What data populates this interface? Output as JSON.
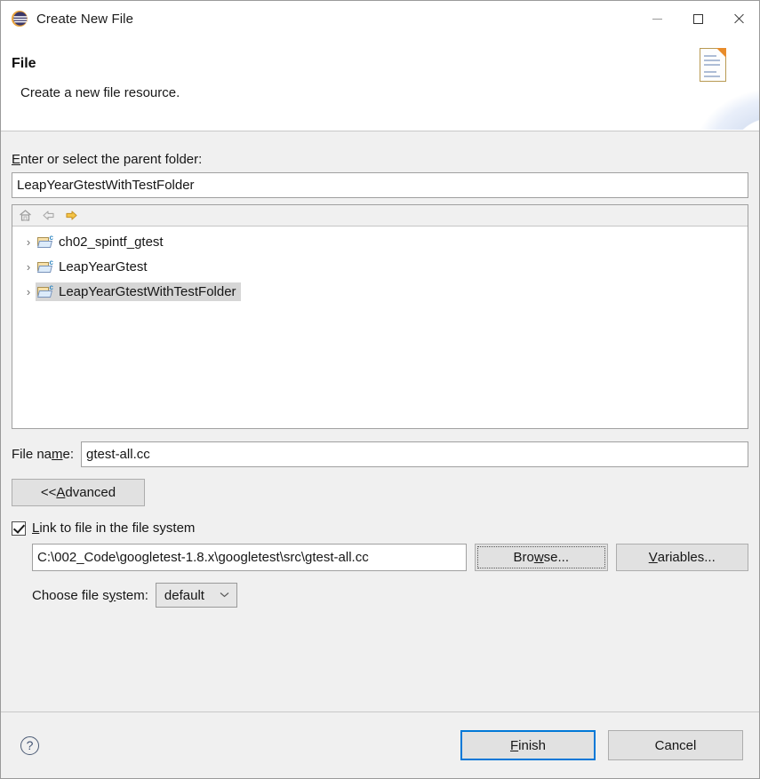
{
  "window": {
    "title": "Create New File",
    "app_icon": "eclipse-icon",
    "controls": {
      "minimize": "minimize-icon",
      "maximize": "maximize-icon",
      "close": "close-icon"
    }
  },
  "header": {
    "title": "File",
    "subtitle": "Create a new file resource.",
    "banner_icon": "document-icon"
  },
  "parent_folder": {
    "label_pre": "",
    "label_mnemonic": "E",
    "label_post": "nter or select the parent folder:",
    "value": "LeapYearGtestWithTestFolder",
    "toolbar": [
      {
        "name": "home-icon",
        "title": "Home"
      },
      {
        "name": "back-arrow-icon",
        "title": "Back"
      },
      {
        "name": "forward-arrow-icon",
        "title": "Forward"
      }
    ],
    "tree": [
      {
        "label": "ch02_spintf_gtest",
        "icon": "cpp-project-folder-icon",
        "expander": "›",
        "selected": false
      },
      {
        "label": "LeapYearGtest",
        "icon": "cpp-project-folder-icon",
        "expander": "›",
        "selected": false
      },
      {
        "label": "LeapYearGtestWithTestFolder",
        "icon": "cpp-project-folder-icon",
        "expander": "›",
        "selected": true
      }
    ]
  },
  "file_name": {
    "label_pre": "File na",
    "label_mnemonic": "m",
    "label_post": "e:",
    "value": "gtest-all.cc"
  },
  "advanced_button": {
    "label_pre": "<< ",
    "label_mnemonic": "A",
    "label_post": "dvanced"
  },
  "link_section": {
    "checkbox": {
      "checked": true,
      "label_pre": "",
      "label_mnemonic": "L",
      "label_post": "ink to file in the file system"
    },
    "path_value": "C:\\002_Code\\googletest-1.8.x\\googletest\\src\\gtest-all.cc",
    "browse_button": {
      "label_pre": "Bro",
      "label_mnemonic": "w",
      "label_post": "se...",
      "focused": true
    },
    "variables_button": {
      "label_pre": "",
      "label_mnemonic": "V",
      "label_post": "ariables..."
    },
    "file_system": {
      "label_pre": "Choose file s",
      "label_mnemonic": "y",
      "label_post": "stem:",
      "selected": "default",
      "chevron": "⌄"
    }
  },
  "footer": {
    "help_icon": "help-icon",
    "help_glyph": "?",
    "finish_button": {
      "label_pre": "",
      "label_mnemonic": "F",
      "label_post": "inish",
      "is_default": true
    },
    "cancel_button": {
      "label": "Cancel"
    }
  },
  "colors": {
    "accent": "#0078d7",
    "dialog_bg": "#f0f0f0",
    "field_bg": "#ffffff",
    "selection": "#d6d6d6",
    "button_bg": "#e1e1e1"
  }
}
